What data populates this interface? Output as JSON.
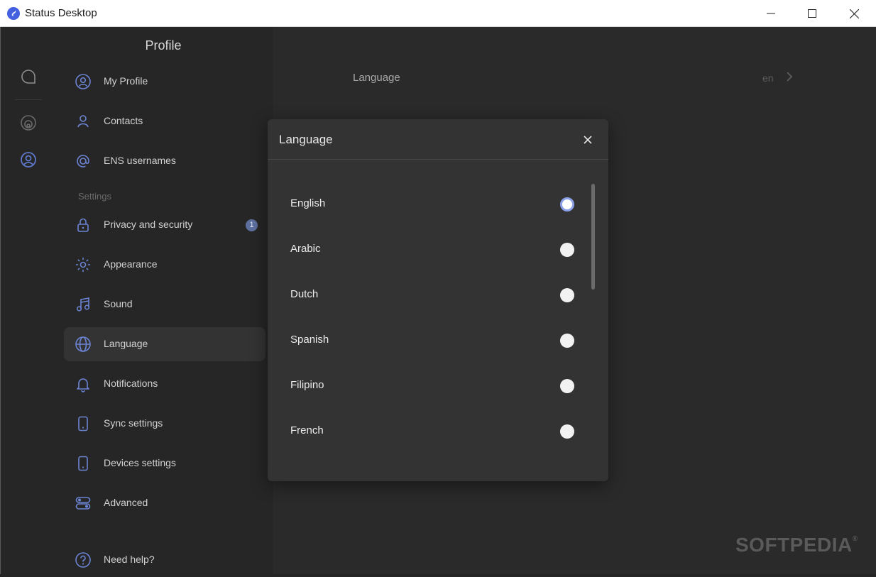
{
  "window": {
    "title": "Status Desktop"
  },
  "sidebar": {
    "title": "Profile",
    "section_label": "Settings",
    "items": [
      {
        "label": "My Profile",
        "icon": "user-circle-icon"
      },
      {
        "label": "Contacts",
        "icon": "contact-icon"
      },
      {
        "label": "ENS usernames",
        "icon": "at-icon"
      },
      {
        "label": "Privacy and security",
        "icon": "lock-icon",
        "badge": "1"
      },
      {
        "label": "Appearance",
        "icon": "sun-icon"
      },
      {
        "label": "Sound",
        "icon": "music-note-icon"
      },
      {
        "label": "Language",
        "icon": "globe-icon",
        "active": true
      },
      {
        "label": "Notifications",
        "icon": "bell-icon"
      },
      {
        "label": "Sync settings",
        "icon": "phone-icon"
      },
      {
        "label": "Devices settings",
        "icon": "phone-icon"
      },
      {
        "label": "Advanced",
        "icon": "sliders-icon"
      },
      {
        "label": "Need help?",
        "icon": "help-circle-icon"
      }
    ]
  },
  "main": {
    "language_label": "Language",
    "language_value": "en"
  },
  "modal": {
    "title": "Language",
    "options": [
      {
        "label": "English",
        "selected": true
      },
      {
        "label": "Arabic",
        "selected": false
      },
      {
        "label": "Dutch",
        "selected": false
      },
      {
        "label": "Spanish",
        "selected": false
      },
      {
        "label": "Filipino",
        "selected": false
      },
      {
        "label": "French",
        "selected": false
      }
    ]
  },
  "watermark": {
    "text": "SOFTPEDIA",
    "mark": "®"
  },
  "colors": {
    "accent": "#4360df",
    "radio_selected_ring": "#8aa0e8",
    "badge": "#5d6f9e"
  }
}
